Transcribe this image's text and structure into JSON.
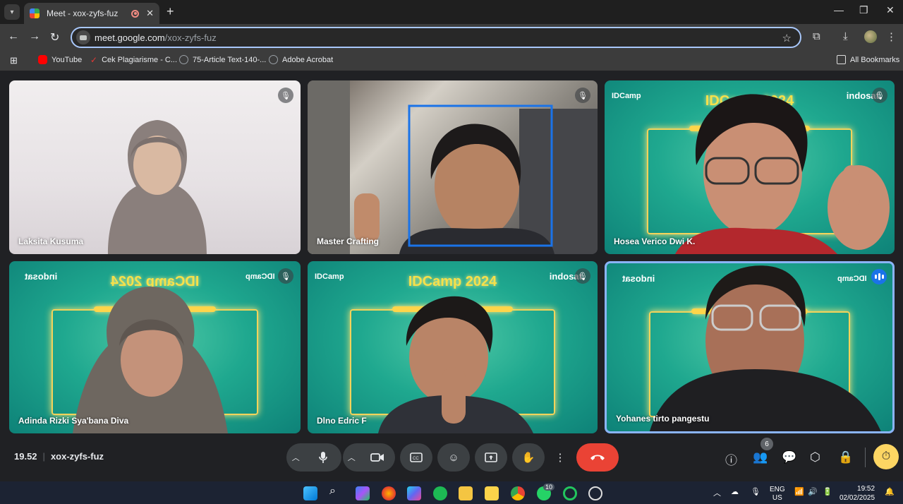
{
  "browser": {
    "tab_title": "Meet - xox-zyfs-fuz",
    "url_host": "meet.google.com",
    "url_path": "/xox-zyfs-fuz",
    "new_tab_symbol": "+",
    "bookmarks": [
      {
        "label": "YouTube",
        "icon": "youtube-icon",
        "color": "#ff0000"
      },
      {
        "label": "Cek Plagiarisme - C...",
        "icon": "check-icon",
        "color": "#e53935"
      },
      {
        "label": "75-Article Text-140-...",
        "icon": "globe-icon",
        "color": "#9aa0a6"
      },
      {
        "label": "Adobe Acrobat",
        "icon": "globe-icon",
        "color": "#9aa0a6"
      }
    ],
    "all_bookmarks_label": "All Bookmarks"
  },
  "meet": {
    "idcamp_title": "IDCamp 2024",
    "idcamp_title_mirrored": "IDCamp 2024",
    "idcamp_logo": "IDCamp",
    "indosat_logo": "indosat",
    "participants": [
      {
        "name": "Laksita Kusuma",
        "muted": true,
        "background": "plain-light"
      },
      {
        "name": "Master Crafting",
        "muted": true,
        "background": "room"
      },
      {
        "name": "Hosea Verico Dwi K.",
        "muted": true,
        "background": "idcamp"
      },
      {
        "name": "Adinda Rizki Sya'bana Diva",
        "muted": true,
        "background": "idcamp-mirrored"
      },
      {
        "name": "Dlno Edric F",
        "muted": true,
        "background": "idcamp"
      },
      {
        "name": "Yohanes tirto pangestu",
        "muted": false,
        "speaking": true,
        "background": "idcamp-mirrored"
      }
    ],
    "time": "19.52",
    "meeting_code": "xox-zyfs-fuz",
    "participant_count": "6",
    "accent_color": "#8ab4f8",
    "end_call_color": "#ea4335"
  },
  "taskbar": {
    "language_line1": "ENG",
    "language_line2": "US",
    "clock_time": "19:52",
    "clock_date": "02/02/2025",
    "whatsapp_badge": "10"
  }
}
